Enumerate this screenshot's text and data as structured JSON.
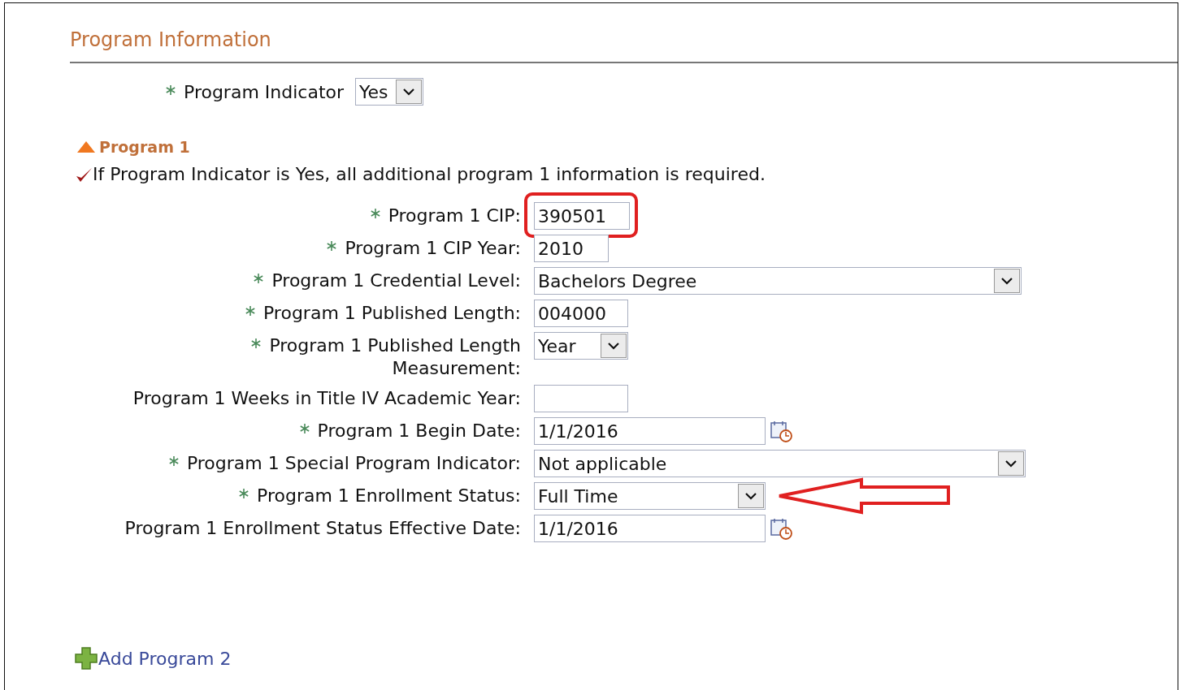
{
  "header": {
    "title": "Program Information"
  },
  "indicator": {
    "label": "Program Indicator",
    "required": true,
    "value": "Yes"
  },
  "section": {
    "title": "Program 1",
    "expanded": true
  },
  "note": "If Program Indicator is Yes, all additional program 1 information is required.",
  "fields": [
    {
      "label": "Program 1 CIP:",
      "required": true,
      "kind": "text",
      "value": "390501",
      "circled": true
    },
    {
      "label": "Program 1 CIP Year:",
      "required": true,
      "kind": "text",
      "value": "2010"
    },
    {
      "label": "Program 1 Credential Level:",
      "required": true,
      "kind": "select",
      "value": "Bachelors Degree"
    },
    {
      "label": "Program 1 Published Length:",
      "required": true,
      "kind": "text",
      "value": "004000"
    },
    {
      "label": "Program 1 Published Length Measurement:",
      "required": true,
      "kind": "select",
      "value": "Year"
    },
    {
      "label": "Program 1 Weeks in Title IV Academic Year:",
      "required": false,
      "kind": "text"
    },
    {
      "label": "Program 1 Begin Date:",
      "required": true,
      "kind": "date",
      "value": "1/1/2016"
    },
    {
      "label": "Program 1 Special Program Indicator:",
      "required": true,
      "kind": "select",
      "value": "Not applicable"
    },
    {
      "label": "Program 1 Enrollment Status:",
      "required": true,
      "kind": "select",
      "value": "Full Time",
      "arrow": true
    },
    {
      "label": "Program 1 Enrollment Status Effective Date:",
      "required": false,
      "kind": "date",
      "value": "1/1/2016"
    }
  ],
  "add_link": "Add Program 2"
}
